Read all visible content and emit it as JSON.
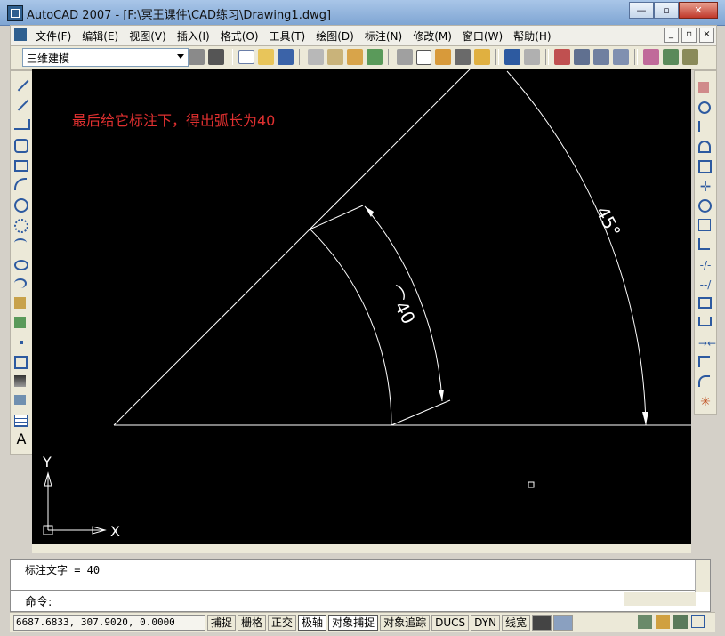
{
  "window": {
    "title": "AutoCAD 2007 - [F:\\冥王课件\\CAD练习\\Drawing1.dwg]",
    "minimize": "—",
    "maximize": "▫",
    "close": "✕"
  },
  "menu": {
    "items": [
      "文件(F)",
      "编辑(E)",
      "视图(V)",
      "插入(I)",
      "格式(O)",
      "工具(T)",
      "绘图(D)",
      "标注(N)",
      "修改(M)",
      "窗口(W)",
      "帮助(H)"
    ],
    "mdi": [
      "_",
      "▫",
      "×"
    ]
  },
  "toolbar": {
    "workspace": "三维建模"
  },
  "drawing": {
    "note": "最后给它标注下，得出弧长为40",
    "arc_dim": "⌒40",
    "angle_dim": "45°",
    "axis_x": "X",
    "axis_y": "Y"
  },
  "command": {
    "history": "标注文字 = 40",
    "prompt": "命令:"
  },
  "status": {
    "coords": "6687.6833, 307.9020, 0.0000",
    "buttons": [
      "捕捉",
      "栅格",
      "正交",
      "极轴",
      "对象捕捉",
      "对象追踪",
      "DUCS",
      "DYN",
      "线宽"
    ]
  },
  "colors": {
    "canvas": "#000000",
    "note": "#e03030",
    "lines": "#ffffff"
  }
}
